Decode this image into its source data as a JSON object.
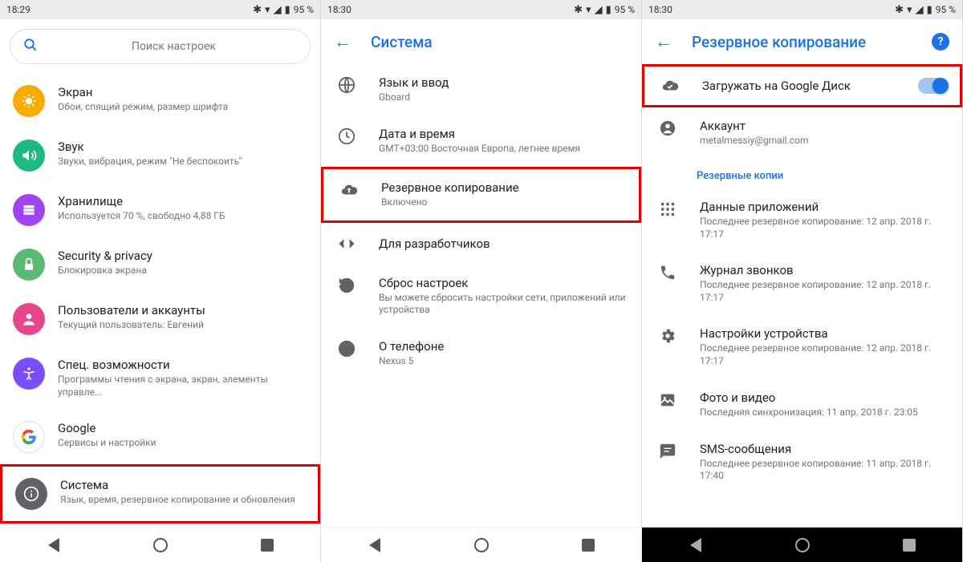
{
  "screen1": {
    "time": "18:29",
    "battery": "95 %",
    "search_placeholder": "Поиск настроек",
    "items": [
      {
        "title": "Экран",
        "subtitle": "Обои, спящий режим, размер шрифта"
      },
      {
        "title": "Звук",
        "subtitle": "Звуки, вибрация, режим \"Не беспокоить\""
      },
      {
        "title": "Хранилище",
        "subtitle": "Используется 70 %, свободно 4,88 ГБ"
      },
      {
        "title": "Security & privacy",
        "subtitle": "Блокировка экрана"
      },
      {
        "title": "Пользователи и аккаунты",
        "subtitle": "Текущий пользователь: Евгений"
      },
      {
        "title": "Спец. возможности",
        "subtitle": "Программы чтения с экрана, экран, элементы управле..."
      },
      {
        "title": "Google",
        "subtitle": "Сервисы и настройки"
      },
      {
        "title": "Система",
        "subtitle": "Язык, время, резервное копирование и обновления"
      }
    ]
  },
  "screen2": {
    "time": "18:30",
    "battery": "95 %",
    "title": "Система",
    "items": [
      {
        "title": "Язык и ввод",
        "subtitle": "Gboard"
      },
      {
        "title": "Дата и время",
        "subtitle": "GMT+03:00 Восточная Европа, летнее время"
      },
      {
        "title": "Резервное копирование",
        "subtitle": "Включено"
      },
      {
        "title": "Для разработчиков",
        "subtitle": ""
      },
      {
        "title": "Сброс настроек",
        "subtitle": "Вы можете сбросить настройки сети, приложений или устройства"
      },
      {
        "title": "О телефоне",
        "subtitle": "Nexus 5"
      }
    ]
  },
  "screen3": {
    "time": "18:30",
    "battery": "95 %",
    "title": "Резервное копирование",
    "upload_label": "Загружать на Google Диск",
    "account_label": "Аккаунт",
    "account_email": "metalmessiy@gmail.com",
    "section": "Резервные копии",
    "backups": [
      {
        "title": "Данные приложений",
        "subtitle": "Последнее резервное копирование: 12 апр. 2018 г. 17:17"
      },
      {
        "title": "Журнал звонков",
        "subtitle": "Последнее резервное копирование: 12 апр. 2018 г. 17:17"
      },
      {
        "title": "Настройки устройства",
        "subtitle": "Последнее резервное копирование: 12 апр. 2018 г. 17:17"
      },
      {
        "title": "Фото и видео",
        "subtitle": "Последняя синхронизация: 11 апр. 2018 г. 23:05"
      },
      {
        "title": "SMS-сообщения",
        "subtitle": "Последнее резервное копирование: 11 апр. 2018 г. 17:40"
      }
    ]
  }
}
